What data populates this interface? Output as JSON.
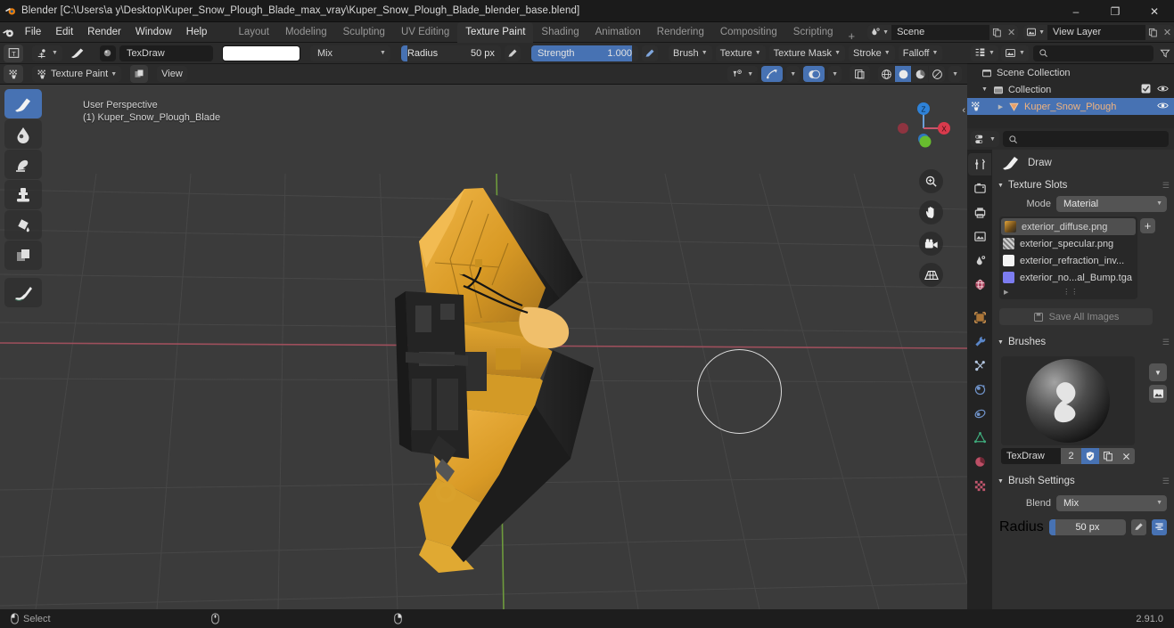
{
  "window": {
    "title": "Blender [C:\\Users\\a y\\Desktop\\Kuper_Snow_Plough_Blade_max_vray\\Kuper_Snow_Plough_Blade_blender_base.blend]",
    "minimize": "–",
    "maximize": "❐",
    "close": "✕"
  },
  "menubar": {
    "items": [
      "File",
      "Edit",
      "Render",
      "Window",
      "Help"
    ]
  },
  "workspaces": {
    "tabs": [
      "Layout",
      "Modeling",
      "Sculpting",
      "UV Editing",
      "Texture Paint",
      "Shading",
      "Animation",
      "Rendering",
      "Compositing",
      "Scripting"
    ],
    "active": "Texture Paint",
    "add": "+"
  },
  "datablocks": {
    "scene": "Scene",
    "view_layer": "View Layer"
  },
  "tool_header": {
    "mode": "Texture Paint",
    "brush_name": "TexDraw",
    "color_hex": "#ffffff",
    "blend": "Mix",
    "radius_label": "Radius",
    "radius_value": "50 px",
    "strength_label": "Strength",
    "strength_value": "1.000",
    "menus": [
      "Brush",
      "Texture",
      "Texture Mask",
      "Stroke",
      "Falloff"
    ],
    "view_menu": "View"
  },
  "viewport": {
    "perspective": "User Perspective",
    "object_line": "(1) Kuper_Snow_Plough_Blade",
    "gizmo_axes": {
      "x": "X",
      "y": "Y",
      "z": "Z"
    },
    "tools": [
      "draw-brush-tool",
      "soften-tool",
      "smear-tool",
      "clone-tool",
      "fill-tool",
      "mask-tool",
      "annotate-tool"
    ],
    "nav_buttons": [
      "zoom-nav",
      "pan-nav",
      "camera-nav",
      "ortho-persp-nav"
    ],
    "shading_modes": [
      "wireframe",
      "solid",
      "material-preview",
      "rendered"
    ],
    "active_shading": "solid",
    "colors": {
      "background": "#3b3b3b",
      "grid": "#4b4b4b",
      "x_axis": "#a94a5a",
      "y_axis": "#6f9b3a",
      "model_yellow": "#e0a32a",
      "model_dark": "#2b2b2b"
    }
  },
  "outliner": {
    "rows": [
      {
        "label": "Scene Collection",
        "icon": "collection-icon",
        "indent": 0,
        "selected": false,
        "twist": "",
        "checkbox": false,
        "eye": false
      },
      {
        "label": "Collection",
        "icon": "collection-icon",
        "indent": 1,
        "selected": false,
        "twist": "▼",
        "checkbox": true,
        "eye": true
      },
      {
        "label": "Kuper_Snow_Plough",
        "icon": "mesh-object-icon",
        "indent": 2,
        "selected": true,
        "twist": "▶",
        "checkbox": false,
        "eye": true
      }
    ],
    "filter_placeholder": ""
  },
  "properties": {
    "search_placeholder": "",
    "active_tool_label": "Draw",
    "tabs": [
      "tool-tab",
      "render-tab",
      "output-tab",
      "view-layer-tab",
      "scene-tab",
      "world-tab",
      "object-tab",
      "modifier-tab",
      "particles-tab",
      "physics-tab",
      "constraints-tab",
      "data-tab",
      "material-tab",
      "texture-tab"
    ],
    "active_tab": "tool-tab",
    "texture_slots": {
      "title": "Texture Slots",
      "mode_label": "Mode",
      "mode_value": "Material",
      "slots": [
        {
          "name": "exterior_diffuse.png",
          "color": "#9a7440",
          "selected": true
        },
        {
          "name": "exterior_specular.png",
          "color": "#b9b9b9",
          "selected": false
        },
        {
          "name": "exterior_refraction_inv...",
          "color": "#f2f2f2",
          "selected": false
        },
        {
          "name": "exterior_no...al_Bump.tga",
          "color": "#7c7cf0",
          "selected": false
        }
      ],
      "save_all_label": "Save All Images"
    },
    "brushes": {
      "title": "Brushes",
      "brush_name": "TexDraw",
      "users_count": "2",
      "fake_user_icon": "shield-icon",
      "duplicate_icon": "copy-icon",
      "unlink_icon": "x-icon"
    },
    "brush_settings": {
      "title": "Brush Settings",
      "blend_label": "Blend",
      "blend_value": "Mix",
      "radius_label": "Radius",
      "radius_value": "50 px"
    }
  },
  "statusbar": {
    "mouse_action": "Select",
    "version": "2.91.0"
  }
}
